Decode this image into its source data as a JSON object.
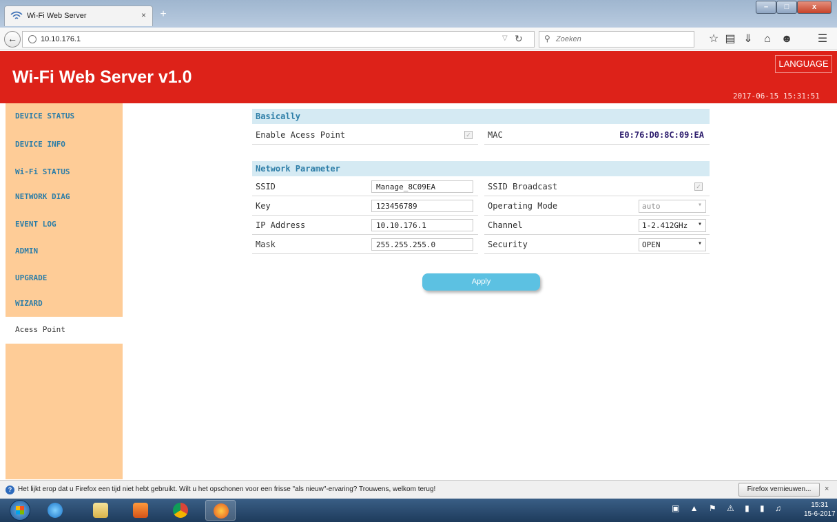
{
  "browser": {
    "tab_title": "Wi-Fi Web Server",
    "tab_close": "×",
    "new_tab": "+",
    "url": "10.10.176.1",
    "search_placeholder": "Zoeken",
    "window_controls": {
      "minimize": "–",
      "maximize": "□",
      "close": "x"
    }
  },
  "header": {
    "title": "Wi-Fi Web Server v1.0",
    "language_button": "LANGUAGE",
    "datetime": "2017-06-15 15:31:51",
    "color": "#dd2219"
  },
  "sidebar": {
    "color": "#fecc97",
    "items": [
      {
        "label": "DEVICE STATUS"
      },
      {
        "label": "DEVICE INFO"
      },
      {
        "label": "Wi-Fi STATUS"
      },
      {
        "label": "NETWORK DIAG"
      },
      {
        "label": "EVENT LOG"
      },
      {
        "label": "ADMIN"
      },
      {
        "label": "UPGRADE"
      },
      {
        "label": "WIZARD"
      },
      {
        "label": "Acess Point",
        "active": true
      }
    ]
  },
  "basically": {
    "heading": "Basically",
    "enable_ap_label": "Enable Acess Point",
    "enable_ap_checked": true,
    "mac_label": "MAC",
    "mac_value": "E0:76:D0:8C:09:EA"
  },
  "network": {
    "heading": "Network Parameter",
    "ssid_label": "SSID",
    "ssid_value": "Manage_8C09EA",
    "ssid_broadcast_label": "SSID Broadcast",
    "ssid_broadcast_checked": true,
    "key_label": "Key",
    "key_value": "123456789",
    "operating_mode_label": "Operating Mode",
    "operating_mode_value": "auto",
    "ip_label": "IP Address",
    "ip_value": "10.10.176.1",
    "channel_label": "Channel",
    "channel_value": "1-2.412GHz",
    "mask_label": "Mask",
    "mask_value": "255.255.255.0",
    "security_label": "Security",
    "security_value": "OPEN"
  },
  "apply_button": "Apply",
  "notification": {
    "text": "Het lijkt erop dat u Firefox een tijd niet hebt gebruikt. Wilt u het opschonen voor een frisse \"als nieuw\"-ervaring? Trouwens, welkom terug!",
    "button": "Firefox vernieuwen...",
    "close": "×"
  },
  "taskbar": {
    "time": "15:31",
    "date": "15-6-2017"
  },
  "accent_color": "#5cc1e2"
}
